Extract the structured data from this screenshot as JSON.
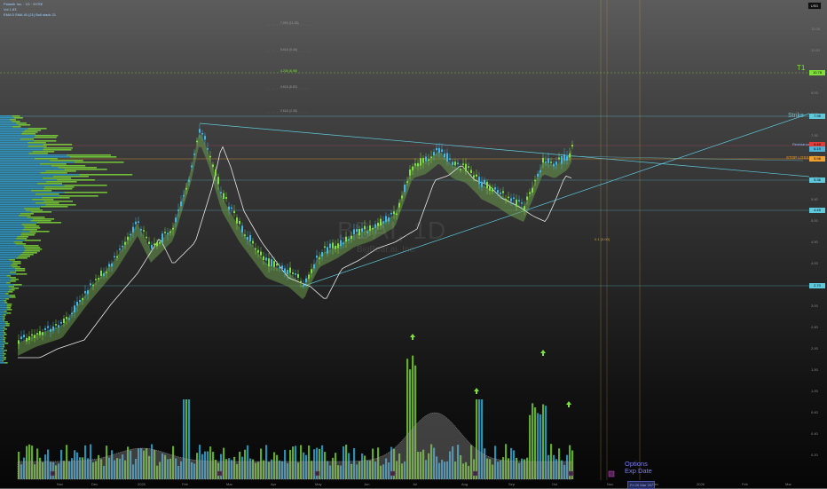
{
  "header": {
    "symbol_line": "Palantir Inc. · 1D · NYSE",
    "line2": "Vol 1.83",
    "line3": "EMA 5 SMA 40 (21) Bull stack 21",
    "currency": "USD"
  },
  "watermark": {
    "symbol": "BBAI, 1D",
    "name": "BigBear.ai, Inc."
  },
  "annotations": {
    "t1": "T1",
    "strike": "Strike",
    "stop_loss": "STOP LOSS",
    "resistance": "Resistance",
    "mid_tag": "0.1  (0.00)",
    "options": "Options\nExp Date",
    "exp_date_tag": "Fri 20 Mar '26"
  },
  "fib_labels": [
    "7.000 (11.35)",
    "5.618 (9.45)",
    "4.236 (6.98)",
    "3.618 (5.83)",
    "2.618 (4.38)"
  ],
  "x_axis": [
    "Nov",
    "Dec",
    "2025",
    "Feb",
    "Mar",
    "Apr",
    "May",
    "Jun",
    "Jul",
    "Aug",
    "Sep",
    "Oct",
    "Nov",
    "Dec",
    "2026",
    "Feb",
    "Mar"
  ],
  "y_axis": [
    "12.00",
    "11.00",
    "10.00",
    "9.00",
    "8.00",
    "7.00",
    "6.50",
    "6.00",
    "5.50",
    "5.00",
    "4.50",
    "4.00",
    "3.50",
    "3.00",
    "2.50",
    "2.00",
    "1.50",
    "1.00",
    "0.60",
    "0.40",
    "0.20"
  ],
  "price_tags": [
    {
      "text": "10.78",
      "color": "#7fe03a"
    },
    {
      "text": "7.98",
      "color": "#5ec8dc"
    },
    {
      "text": "6.48",
      "color": "#e23c3c"
    },
    {
      "text": "6.19",
      "color": "#4fb3d9"
    },
    {
      "text": "5.98",
      "color": "#f0a030"
    },
    {
      "text": "5.36",
      "color": "#5ec8dc"
    },
    {
      "text": "4.45",
      "color": "#5ec8dc"
    },
    {
      "text": "2.70",
      "color": "#5ec8dc"
    }
  ],
  "colors": {
    "bull": "#7fe03a",
    "bear": "#3fb8e8",
    "ribbon_bull": "#6a9a4a",
    "ribbon_bear": "#7a3f7a",
    "ma_line": "#e8e8e8"
  }
}
